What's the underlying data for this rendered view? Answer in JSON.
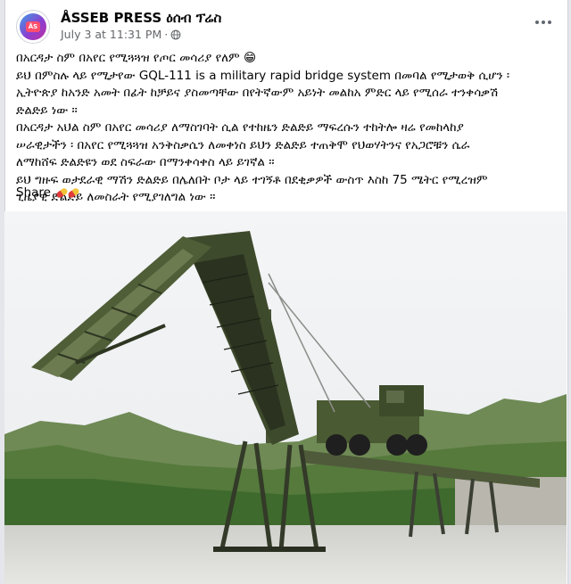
{
  "post": {
    "page_name": "ÅSSEB PRESS ዕሰብ ፕሬስ",
    "avatar_badge": "ÅS",
    "timestamp": "July 3 at 11:31 PM",
    "separator": "·",
    "privacy_icon": "globe-icon",
    "more_icon": "more-options-icon",
    "text_lines": [
      "በአርዳታ ስም በአየር የሚጓጓዝ የጦር መሳሪያ የለም 😁",
      "ይህ በምስሉ ላይ የሚታየው GQL-111 is a military rapid bridge system በመባል የሚታወቅ ሲሆን ፡",
      "ኢትዮጵያ ከአንድ አመት በፊት ከቻይና ያስመጣቸው በየትኛውም አይነት መልከአ ምድር ላይ የሚሰራ ተንቀሳቃሽ",
      "ድልድይ ነው ።",
      "በአርዳታ አህል ስም በአየር መሳሪያ ለማስገባት ሲል የተከዜን ድልድይ ማፍረሱን ተከትሎ ዛሬ የመከላከያ",
      "ሠራዊታችን ፡ በአየር የሚጓጓዝ አንቅስቃሴን ለመቀነስ ይህን ድልድይ ተጠቅሞ የህወሃትንና የአጋሮቹን ሴራ",
      "ለማከሸፍ ድልድዩን ወደ ስፍራው በማንቀሳቀስ ላይ ይገኛል ።",
      " ይህ ግዙፍ ወታደራዊ ማሽን ድልድይ በሌለበት ቦታ ላይ ተገኝቶ በደቂቃዎች ውስጥ እስከ 75 ሜትር የሚረዝም",
      "ጊዜያዊ ድልድይ ለመስራት የሚያገለግል ነው ።"
    ],
    "share_label": "Share",
    "share_emoji": "pill-emoji"
  }
}
